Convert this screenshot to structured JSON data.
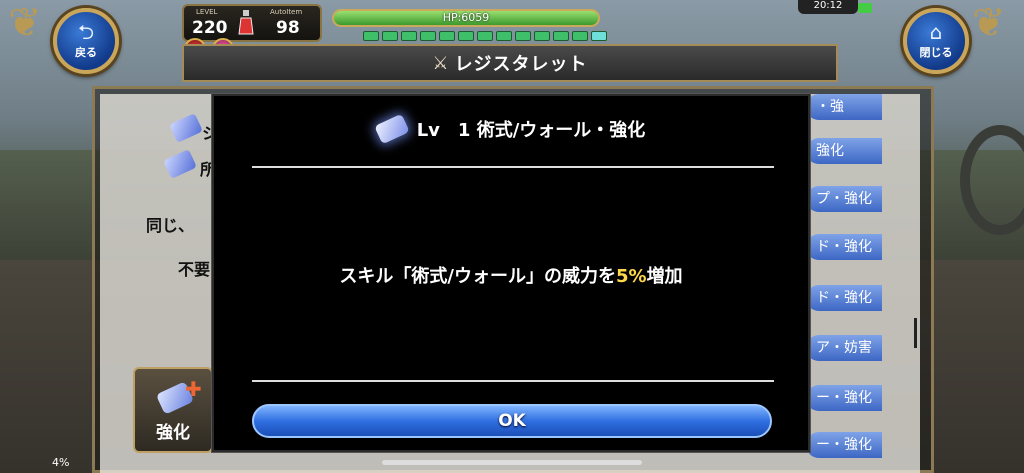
{
  "hud": {
    "back_label": "戻る",
    "close_label": "閉じる",
    "level_caption": "LEVEL",
    "level_value": "220",
    "autoitem_caption": "AutoItem",
    "autoitem_value": "98",
    "hp_text": "HP:6059",
    "time": "20:12"
  },
  "window": {
    "title": "レジスタレット"
  },
  "background": {
    "row1_text": "シ",
    "row2_text": "所",
    "line1": "同じ、",
    "line2": "不要",
    "chips": [
      "・強",
      "強化",
      "プ・強化",
      "ド・強化",
      "ド・強化",
      "ア・妨害",
      "ー・強化",
      "ー・強化"
    ],
    "enhance_label": "強化",
    "exp_text": "4%"
  },
  "modal": {
    "title": "Lv　1 術式/ウォール・強化",
    "desc_before": "スキル「術式/ウォール」の威力を",
    "desc_highlight": "5%",
    "desc_after": "増加",
    "ok_label": "OK"
  },
  "colors": {
    "accent_gold": "#c9a65a",
    "button_blue": "#2f6fe0",
    "highlight_yellow": "#ffd84a",
    "hp_green": "#3c9a2e"
  }
}
